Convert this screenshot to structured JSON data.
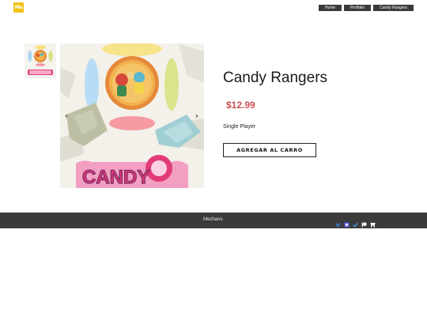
{
  "header": {
    "logo_text": "Me",
    "nav": [
      {
        "label": "Home"
      },
      {
        "label": "Portfolio"
      },
      {
        "label": "Candy Rangers"
      }
    ]
  },
  "product": {
    "title": "Candy Rangers",
    "price": "$12.99",
    "variant": "Single Player",
    "add_to_cart_label": "AGREGAR AL CARRO",
    "gallery": {
      "prev_icon": "chevron-left-icon",
      "next_icon": "chevron-right-icon",
      "image_text": "CANDY"
    }
  },
  "footer": {
    "text": "Mechano",
    "social_icons": [
      "bluesky-icon",
      "mastodon-icon",
      "check-icon",
      "patreon-icon",
      "store-icon"
    ]
  },
  "colors": {
    "accent_logo": "#f2c21b",
    "price": "#c9504f",
    "nav_bg": "#3a3a3a",
    "footer_bg": "#3b3b3b"
  }
}
